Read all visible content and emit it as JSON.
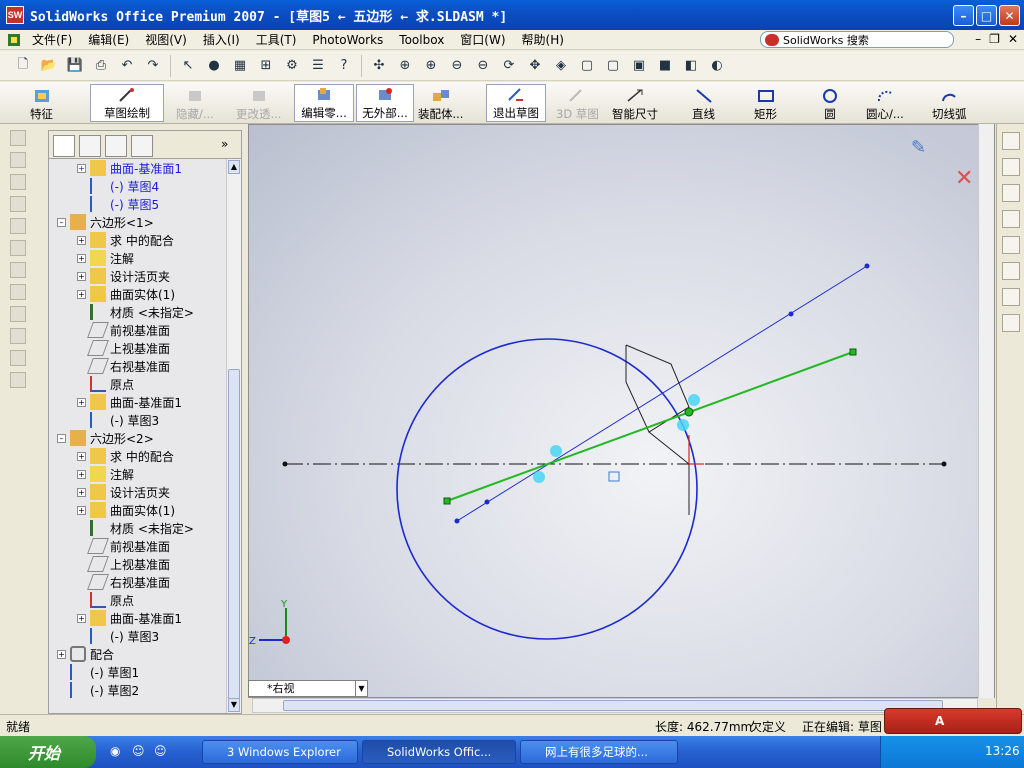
{
  "window": {
    "title": "SolidWorks Office Premium 2007 - [草图5 ← 五边形 ← 求.SLDASM *]",
    "app_icon_text": "SW"
  },
  "menu": {
    "items": [
      "文件(F)",
      "编辑(E)",
      "视图(V)",
      "插入(I)",
      "工具(T)",
      "PhotoWorks",
      "Toolbox",
      "窗口(W)",
      "帮助(H)"
    ],
    "search_label": "SolidWorks 搜索"
  },
  "command_manager": {
    "items": [
      {
        "label": "特征",
        "enabled": true
      },
      {
        "label": "草图绘制",
        "enabled": true
      },
      {
        "label": "隐藏/...",
        "enabled": false
      },
      {
        "label": "更改透...",
        "enabled": false
      },
      {
        "label": "编辑零...",
        "enabled": true
      },
      {
        "label": "无外部...",
        "enabled": true
      },
      {
        "label": "装配体...",
        "enabled": true
      },
      {
        "label": "退出草图",
        "enabled": true
      },
      {
        "label": "3D 草图",
        "enabled": false
      },
      {
        "label": "智能尺寸",
        "enabled": true
      },
      {
        "label": "直线",
        "enabled": true
      },
      {
        "label": "矩形",
        "enabled": true
      },
      {
        "label": "圆",
        "enabled": true
      },
      {
        "label": "圆心/...",
        "enabled": true
      },
      {
        "label": "切线弧",
        "enabled": true
      }
    ]
  },
  "tree": {
    "rows": [
      {
        "label": "曲面-基准面1",
        "blue": true
      },
      {
        "label": "(-) 草图4",
        "blue": true
      },
      {
        "label": "(-) 草图5",
        "blue": true
      },
      {
        "label": "六边形<1>",
        "blue": false
      },
      {
        "label": "求 中的配合",
        "blue": false
      },
      {
        "label": "注解",
        "blue": false
      },
      {
        "label": "设计活页夹",
        "blue": false
      },
      {
        "label": "曲面实体(1)",
        "blue": false
      },
      {
        "label": "材质 <未指定>",
        "blue": false
      },
      {
        "label": "前视基准面",
        "blue": false
      },
      {
        "label": "上视基准面",
        "blue": false
      },
      {
        "label": "右视基准面",
        "blue": false
      },
      {
        "label": "原点",
        "blue": false
      },
      {
        "label": "曲面-基准面1",
        "blue": false
      },
      {
        "label": "(-) 草图3",
        "blue": false
      },
      {
        "label": "六边形<2>",
        "blue": false
      },
      {
        "label": "求 中的配合",
        "blue": false
      },
      {
        "label": "注解",
        "blue": false
      },
      {
        "label": "设计活页夹",
        "blue": false
      },
      {
        "label": "曲面实体(1)",
        "blue": false
      },
      {
        "label": "材质 <未指定>",
        "blue": false
      },
      {
        "label": "前视基准面",
        "blue": false
      },
      {
        "label": "上视基准面",
        "blue": false
      },
      {
        "label": "右视基准面",
        "blue": false
      },
      {
        "label": "原点",
        "blue": false
      },
      {
        "label": "曲面-基准面1",
        "blue": false
      },
      {
        "label": "(-) 草图3",
        "blue": false
      },
      {
        "label": "配合",
        "blue": false
      },
      {
        "label": "(-) 草图1",
        "blue": false
      },
      {
        "label": "(-) 草图2",
        "blue": false
      }
    ]
  },
  "viewport": {
    "view_name": "*右视",
    "triad_y": "Y",
    "triad_z": "Z"
  },
  "status": {
    "left": "就绪",
    "length": "长度: 462.77mm",
    "defined": "欠定义",
    "editing": "正在编辑: 草图"
  },
  "taskbar": {
    "start": "开始",
    "tasks": [
      "3 Windows Explorer",
      "SolidWorks Offic...",
      "网上有很多足球的..."
    ],
    "clock": "13:26"
  },
  "ime_label": "A"
}
